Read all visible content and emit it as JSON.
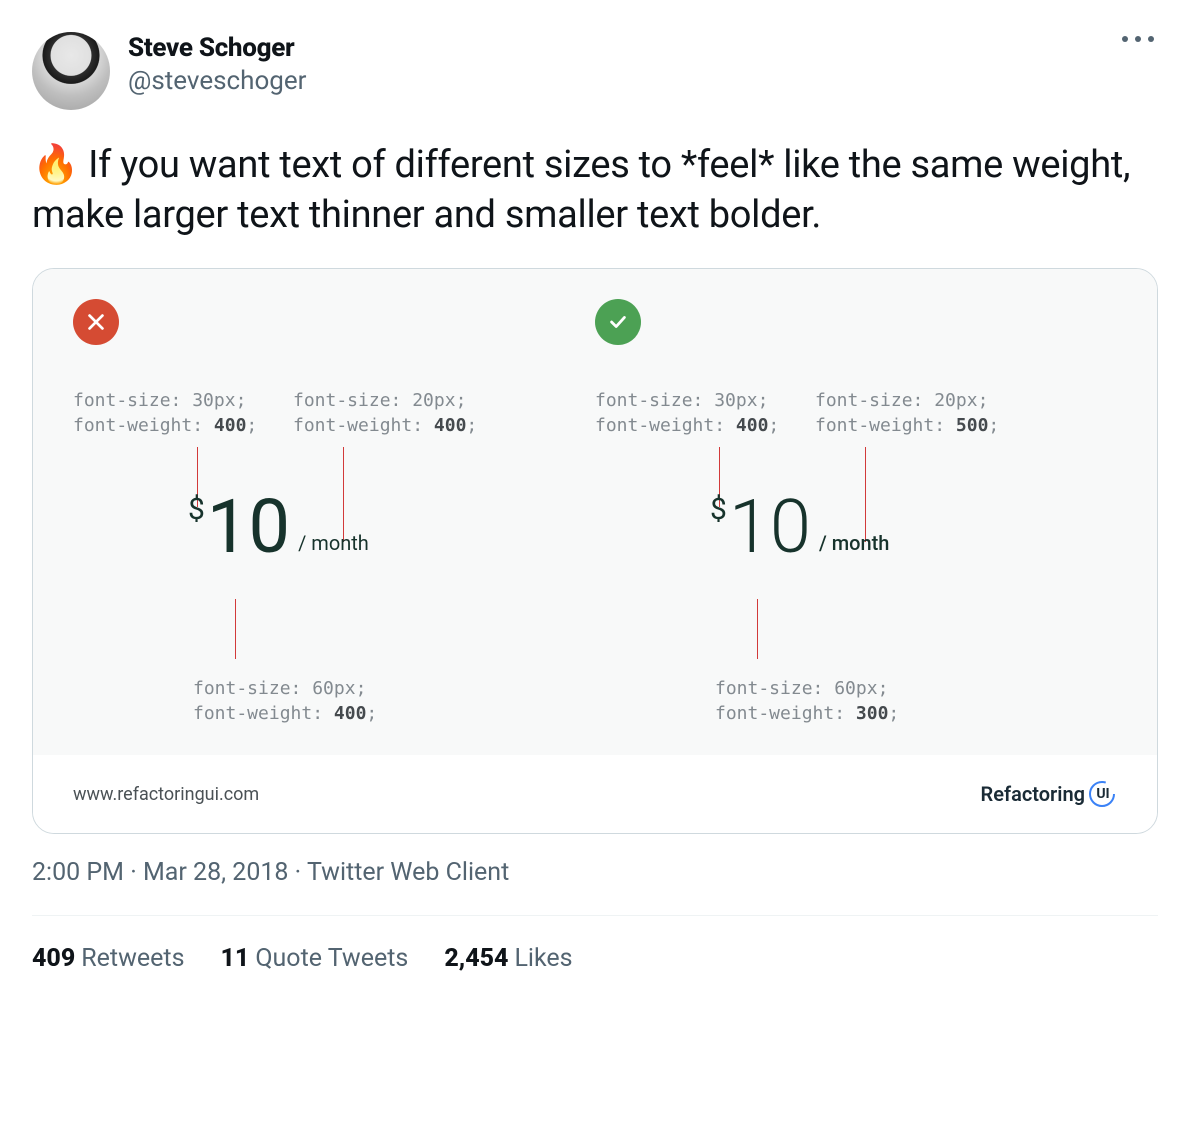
{
  "author": {
    "name": "Steve Schoger",
    "handle": "@steveschoger"
  },
  "body": {
    "emoji": "🔥",
    "text": " If you want text of different sizes to *feel* like the same weight, make larger text thinner and smaller text bolder."
  },
  "card": {
    "bad": {
      "dollar_annot": {
        "size": "30px",
        "weight": "400"
      },
      "month_annot": {
        "size": "20px",
        "weight": "400"
      },
      "amount_annot": {
        "size": "60px",
        "weight": "400"
      },
      "price": {
        "currency": "$",
        "amount": "10",
        "per": "/ month"
      }
    },
    "good": {
      "dollar_annot": {
        "size": "30px",
        "weight": "400"
      },
      "month_annot": {
        "size": "20px",
        "weight": "500"
      },
      "amount_annot": {
        "size": "60px",
        "weight": "300"
      },
      "price": {
        "currency": "$",
        "amount": "10",
        "per": "/ month"
      }
    },
    "footer_url": "www.refactoringui.com",
    "brand_text": "Refactoring",
    "brand_ui": "UI"
  },
  "meta": {
    "time": "2:00 PM",
    "date": "Mar 28, 2018",
    "source": "Twitter Web Client"
  },
  "stats": {
    "retweets": {
      "count": "409",
      "label": "Retweets"
    },
    "quotes": {
      "count": "11",
      "label": "Quote Tweets"
    },
    "likes": {
      "count": "2,454",
      "label": "Likes"
    }
  },
  "labels": {
    "font_size": "font-size: ",
    "font_weight": "font-weight: "
  }
}
